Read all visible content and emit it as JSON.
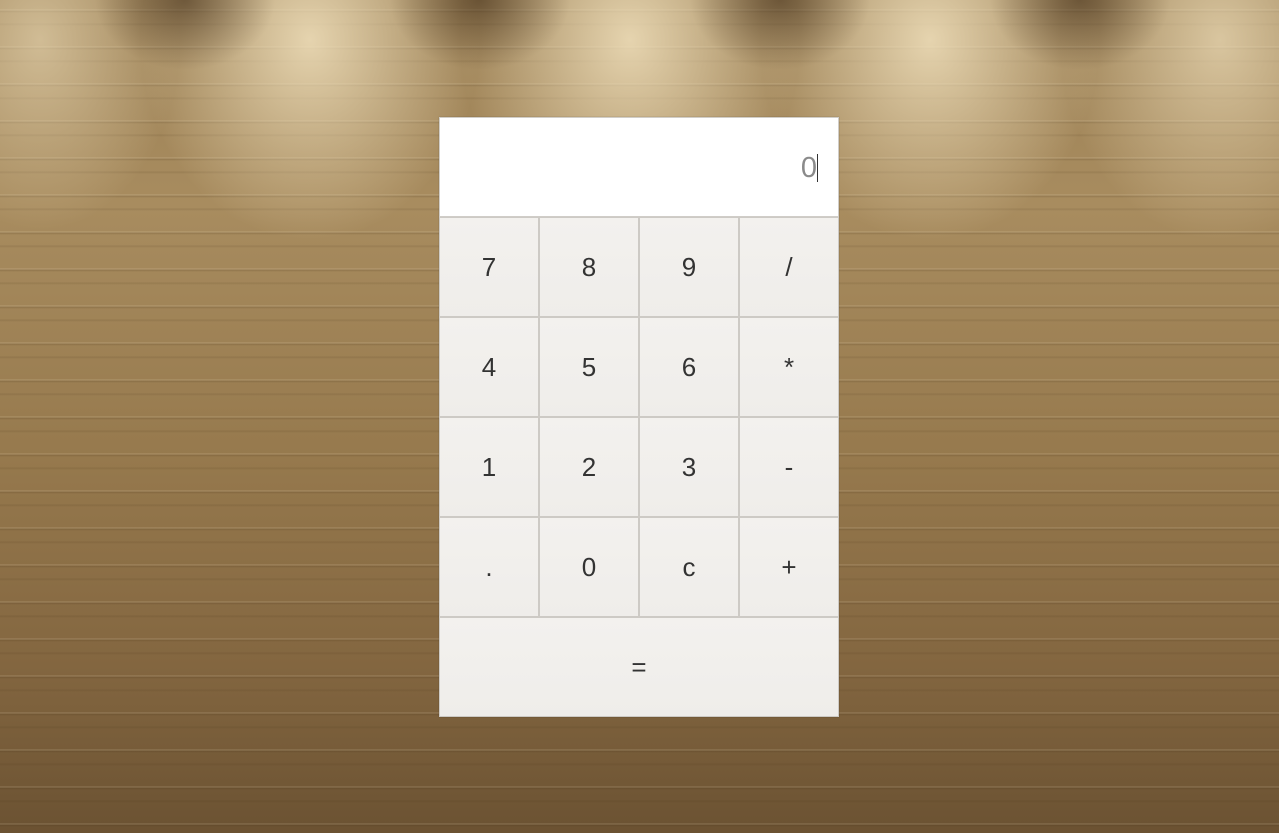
{
  "calculator": {
    "display_value": "0",
    "keys": {
      "k7": "7",
      "k8": "8",
      "k9": "9",
      "div": "/",
      "k4": "4",
      "k5": "5",
      "k6": "6",
      "mul": "*",
      "k1": "1",
      "k2": "2",
      "k3": "3",
      "sub": "-",
      "dot": ".",
      "k0": "0",
      "clear": "c",
      "add": "+",
      "equals": "="
    }
  }
}
